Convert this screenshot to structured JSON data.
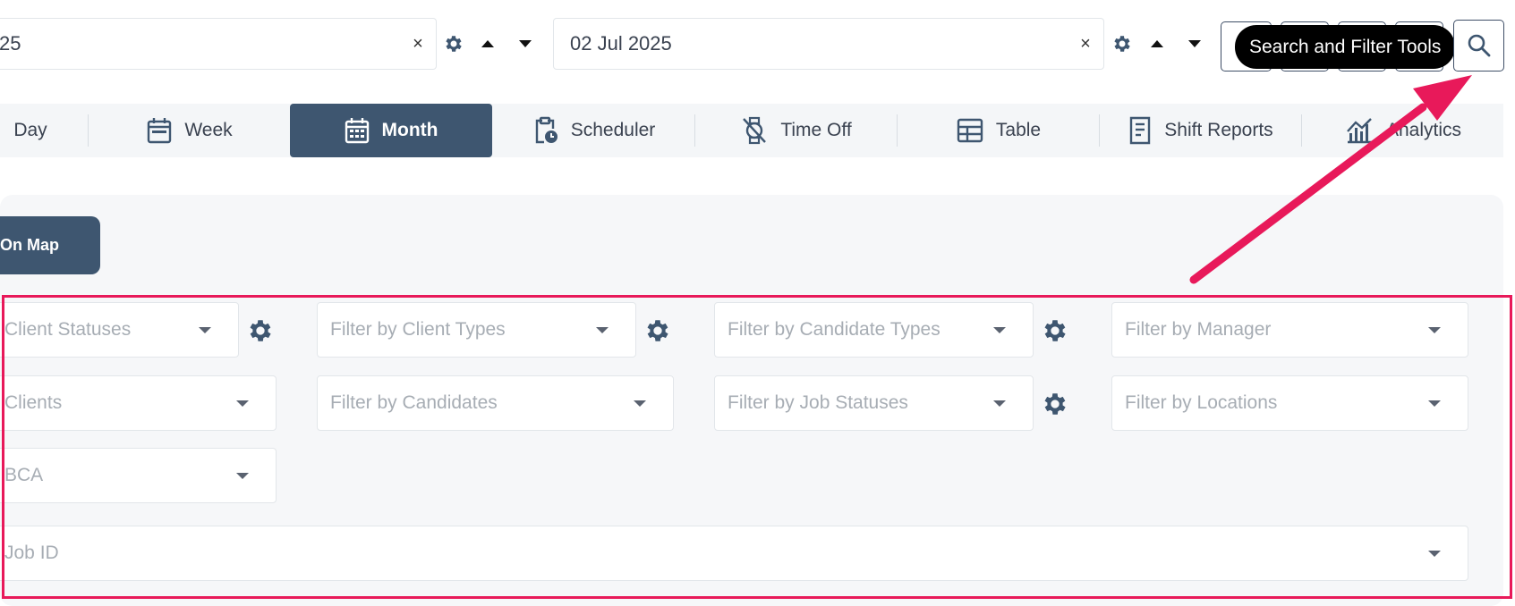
{
  "date_range": {
    "start_value": "25",
    "end_value": "02 Jul 2025",
    "clear_glyph": "×"
  },
  "toolbar": {
    "tooltip": "Search and Filter Tools"
  },
  "tabs": [
    {
      "label": "Day",
      "icon": "none"
    },
    {
      "label": "Week",
      "icon": "calendar-week-icon"
    },
    {
      "label": "Month",
      "icon": "calendar-month-icon",
      "active": true
    },
    {
      "label": "Scheduler",
      "icon": "clipboard-clock-icon"
    },
    {
      "label": "Time Off",
      "icon": "no-watch-icon"
    },
    {
      "label": "Table",
      "icon": "table-icon"
    },
    {
      "label": "Shift Reports",
      "icon": "report-icon"
    },
    {
      "label": "Analytics",
      "icon": "analytics-chart-icon"
    }
  ],
  "panel": {
    "map_button": "On Map",
    "filters": {
      "client_statuses": "Client Statuses",
      "client_types": "Filter by Client Types",
      "candidate_types": "Filter by Candidate Types",
      "manager": "Filter by Manager",
      "clients": "Clients",
      "candidates": "Filter by Candidates",
      "job_statuses": "Filter by Job Statuses",
      "locations": "Filter by Locations",
      "bca": "BCA",
      "job_id": "Job ID"
    }
  },
  "colors": {
    "accent": "#3e5670",
    "highlight": "#e8195a",
    "tooltip_bg": "#000000"
  }
}
